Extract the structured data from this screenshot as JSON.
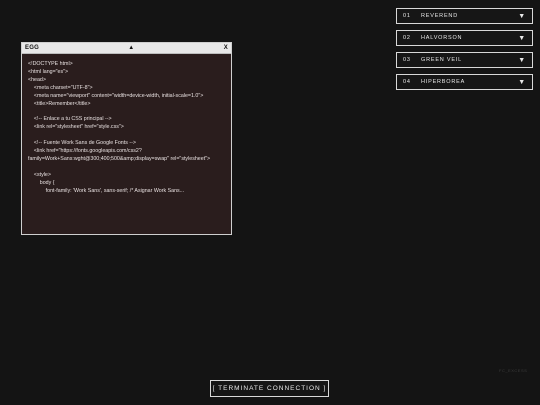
{
  "window": {
    "title": "EGG",
    "center_icon": "▲",
    "close_label": "X",
    "code_lines": [
      "<!DOCTYPE html>",
      "<html lang=\"es\">",
      "<head>",
      "    <meta charset=\"UTF-8\">",
      "    <meta name=\"viewport\" content=\"width=device-width, initial-scale=1.0\">",
      "    <title>Remember</title>",
      "",
      "    <!-- Enlace a tu CSS principal -->",
      "    <link rel=\"stylesheet\" href=\"style.css\">",
      "",
      "    <!-- Fuente Work Sans de Google Fonts -->",
      "    <link href=\"https://fonts.googleapis.com/css2?family=Work+Sans:wght@300;400;500&amp;display=swap\" rel=\"stylesheet\">",
      "",
      "    <style>",
      "        body {",
      "            font-family: 'Work Sans', sans-serif; /* Asignar Work Sans..."
    ]
  },
  "menu": {
    "items": [
      {
        "num": "01",
        "label": "REVEREND",
        "arrow": "▼"
      },
      {
        "num": "02",
        "label": "HALVORSON",
        "arrow": "▼"
      },
      {
        "num": "03",
        "label": "GREEN VEIL",
        "arrow": "▼"
      },
      {
        "num": "04",
        "label": "HIPERBOREA",
        "arrow": "▼"
      }
    ]
  },
  "watermark": "FC_EXCESS",
  "terminate_label": "[ TERMINATE CONNECTION ]"
}
